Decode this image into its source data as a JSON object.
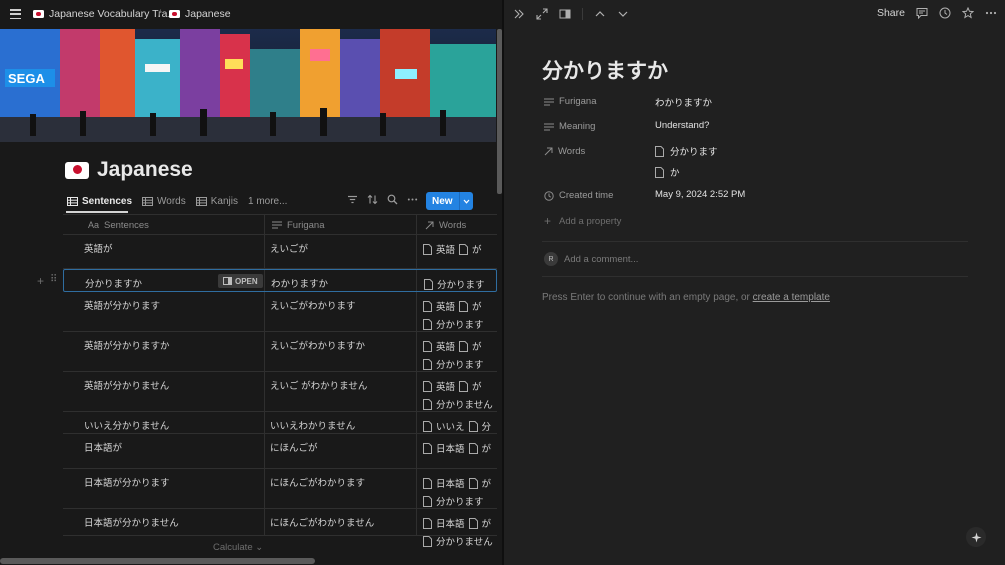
{
  "breadcrumb": {
    "item1": "Japanese Vocabulary Tra...",
    "separator": "/",
    "item2": "Japanese"
  },
  "page": {
    "title": "Japanese"
  },
  "views": {
    "tabs": [
      "Sentences",
      "Words",
      "Kanjis"
    ],
    "more": "1 more...",
    "new_label": "New"
  },
  "table": {
    "headers": {
      "sentences": "Sentences",
      "furigana": "Furigana",
      "words": "Words"
    },
    "open_label": "OPEN",
    "rows": [
      {
        "sentence": "英語が",
        "furigana": "えいごが",
        "words": [
          [
            "英語",
            "が"
          ]
        ]
      },
      {
        "sentence": "分かりますか",
        "furigana": "わかりますか",
        "words": [
          [
            "分かります"
          ]
        ]
      },
      {
        "sentence": "英語が分かります",
        "furigana": "えいごがわかります",
        "words": [
          [
            "英語",
            "が"
          ],
          [
            "分かります"
          ]
        ]
      },
      {
        "sentence": "英語が分かりますか",
        "furigana": "えいごがわかりますか",
        "words": [
          [
            "英語",
            "が"
          ],
          [
            "分かります"
          ]
        ]
      },
      {
        "sentence": "英語が分かりません",
        "furigana": "えいご がわかりません",
        "words": [
          [
            "英語",
            "が"
          ],
          [
            "分かりません"
          ]
        ]
      },
      {
        "sentence": "いいえ分かりません",
        "furigana": "いいえわかりません",
        "words": [
          [
            "いいえ",
            "分"
          ]
        ]
      },
      {
        "sentence": "日本語が",
        "furigana": "にほんごが",
        "words": [
          [
            "日本語",
            "が"
          ]
        ]
      },
      {
        "sentence": "日本語が分かります",
        "furigana": "にほんごがわかります",
        "words": [
          [
            "日本語",
            "が"
          ],
          [
            "分かります"
          ]
        ]
      },
      {
        "sentence": "日本語が分かりません",
        "furigana": "にほんごがわかりません",
        "words": [
          [
            "日本語",
            "が"
          ],
          [
            "分かりません"
          ]
        ]
      }
    ],
    "calculate": "Calculate"
  },
  "detail": {
    "share": "Share",
    "title": "分かりますか",
    "props": {
      "furigana_label": "Furigana",
      "furigana_value": "わかりますか",
      "meaning_label": "Meaning",
      "meaning_value": "Understand?",
      "words_label": "Words",
      "word1": "分かります",
      "word2": "か",
      "created_label": "Created time",
      "created_value": "May 9, 2024 2:52 PM",
      "add_property": "Add a property"
    },
    "avatar": "R",
    "comment_placeholder": "Add a comment...",
    "hint_prefix": "Press Enter to continue with an empty page, or",
    "hint_link": "create a template"
  },
  "colors": {
    "accent": "#2383e2",
    "background": "#191919",
    "panel": "#202020"
  }
}
